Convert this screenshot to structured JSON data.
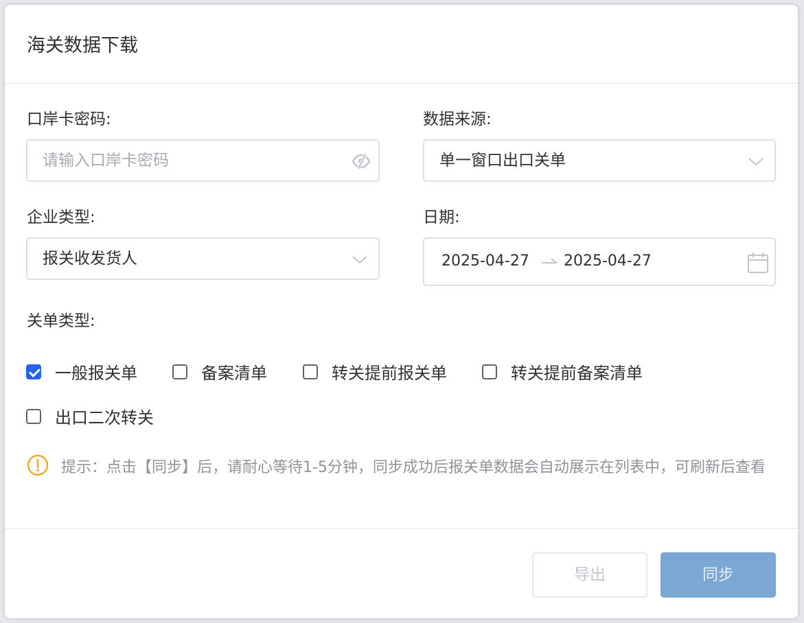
{
  "dialog": {
    "title": "海关数据下载"
  },
  "form": {
    "password": {
      "label": "口岸卡密码:",
      "placeholder": "请输入口岸卡密码",
      "value": "",
      "suffix_icon": "eye-off-icon"
    },
    "source": {
      "label": "数据来源:",
      "value": "单一窗口出口关单",
      "suffix_icon": "chevron-down-icon"
    },
    "company_type": {
      "label": "企业类型:",
      "value": "报关收发货人",
      "suffix_icon": "chevron-down-icon"
    },
    "date": {
      "label": "日期:",
      "start": "2025-04-27",
      "end": "2025-04-27",
      "suffix_icon": "calendar-icon"
    },
    "declaration_type": {
      "label": "关单类型:",
      "options": [
        {
          "label": "一般报关单",
          "checked": true
        },
        {
          "label": "备案清单",
          "checked": false
        },
        {
          "label": "转关提前报关单",
          "checked": false
        },
        {
          "label": "转关提前备案清单",
          "checked": false
        },
        {
          "label": "出口二次转关",
          "checked": false
        }
      ]
    }
  },
  "tip": {
    "icon": "warning-circle-icon",
    "text": "提示：点击【同步】后，请耐心等待1-5分钟，同步成功后报关单数据会自动展示在列表中，可刷新后查看"
  },
  "footer": {
    "export_label": "导出",
    "sync_label": "同步"
  },
  "colors": {
    "primary": "#2563eb",
    "warning": "#f5a623",
    "disabled_primary": "#7ba7d4"
  }
}
